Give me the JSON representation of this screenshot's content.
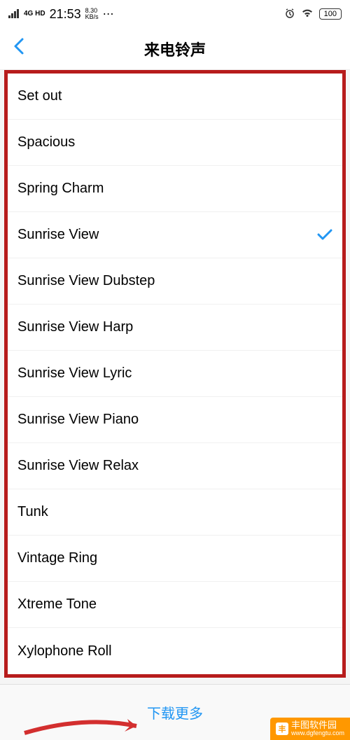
{
  "status_bar": {
    "network_type": "4G HD",
    "time": "21:53",
    "data_rate": "8.30",
    "data_unit": "KB/s",
    "battery": "100"
  },
  "header": {
    "title": "来电铃声"
  },
  "ringtones": [
    {
      "name": "Set out",
      "selected": false
    },
    {
      "name": "Spacious",
      "selected": false
    },
    {
      "name": "Spring Charm",
      "selected": false
    },
    {
      "name": "Sunrise View",
      "selected": true
    },
    {
      "name": "Sunrise View Dubstep",
      "selected": false
    },
    {
      "name": "Sunrise View Harp",
      "selected": false
    },
    {
      "name": "Sunrise View Lyric",
      "selected": false
    },
    {
      "name": "Sunrise View Piano",
      "selected": false
    },
    {
      "name": "Sunrise View Relax",
      "selected": false
    },
    {
      "name": "Tunk",
      "selected": false
    },
    {
      "name": "Vintage Ring",
      "selected": false
    },
    {
      "name": "Xtreme Tone",
      "selected": false
    },
    {
      "name": "Xylophone Roll",
      "selected": false
    }
  ],
  "footer": {
    "download_more": "下载更多"
  },
  "watermark": {
    "name": "丰图软件园",
    "url": "www.dgfengtu.com"
  }
}
